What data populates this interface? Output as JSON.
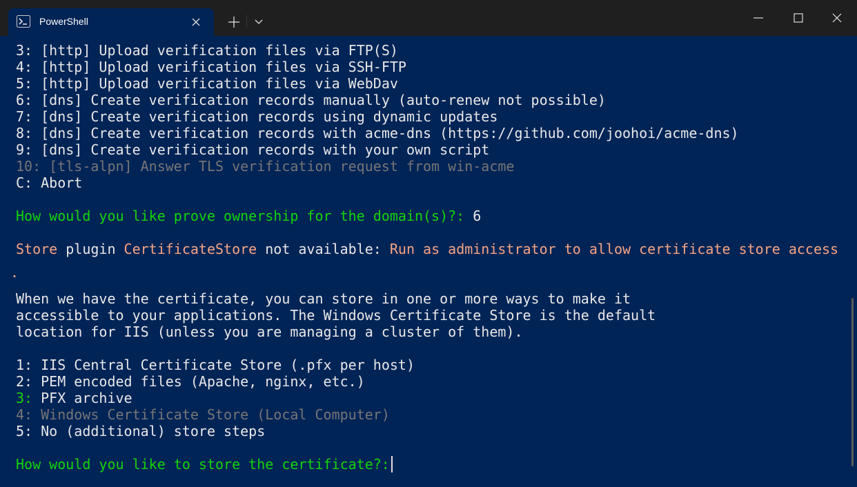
{
  "window": {
    "tab_title": "PowerShell",
    "icons": {
      "tab": "powershell-icon",
      "tab_close": "close-icon",
      "new_tab": "plus-icon",
      "dropdown": "chevron-down-icon",
      "minimize": "minimize-icon",
      "maximize": "maximize-icon",
      "close": "close-icon"
    }
  },
  "colors": {
    "background": "#012456",
    "titlebar": "#1f1f1f",
    "text": "#cccccc",
    "dim": "#767676",
    "prompt_green": "#13d20b",
    "warning_orange": "#f6a584"
  },
  "terminal": {
    "validation_options": [
      {
        "num": "3:",
        "text": " [http] Upload verification files via FTP(S)"
      },
      {
        "num": "4:",
        "text": " [http] Upload verification files via SSH-FTP"
      },
      {
        "num": "5:",
        "text": " [http] Upload verification files via WebDav"
      },
      {
        "num": "6:",
        "text": " [dns] Create verification records manually (auto-renew not possible)"
      },
      {
        "num": "7:",
        "text": " [dns] Create verification records using dynamic updates"
      },
      {
        "num": "8:",
        "text": " [dns] Create verification records with acme-dns (https://github.com/joohoi/acme-dns)"
      },
      {
        "num": "9:",
        "text": " [dns] Create verification records with your own script"
      },
      {
        "num": "10:",
        "text": " [tls-alpn] Answer TLS verification request from win-acme"
      },
      {
        "num": "C:",
        "text": " Abort"
      }
    ],
    "ownership_prompt": "How would you like prove ownership for the domain(s)?:",
    "ownership_answer": " 6",
    "warning": {
      "part1": "Store",
      "part2": " plugin ",
      "part3": "CertificateStore",
      "part4": " not available: ",
      "part5": "Run as administrator to allow certificate store access",
      "wrap": "."
    },
    "info_lines": [
      "When we have the certificate, you can store in one or more ways to make it",
      "accessible to your applications. The Windows Certificate Store is the default",
      "location for IIS (unless you are managing a cluster of them)."
    ],
    "store_options": [
      {
        "num": "1:",
        "text": " IIS Central Certificate Store (.pfx per host)"
      },
      {
        "num": "2:",
        "text": " PEM encoded files (Apache, nginx, etc.)"
      },
      {
        "num": "3:",
        "text": " PFX archive"
      },
      {
        "num": "4:",
        "text": " Windows Certificate Store (Local Computer)"
      },
      {
        "num": "5:",
        "text": " No (additional) store steps"
      }
    ],
    "store_prompt": "How would you like to store the certificate?:"
  }
}
